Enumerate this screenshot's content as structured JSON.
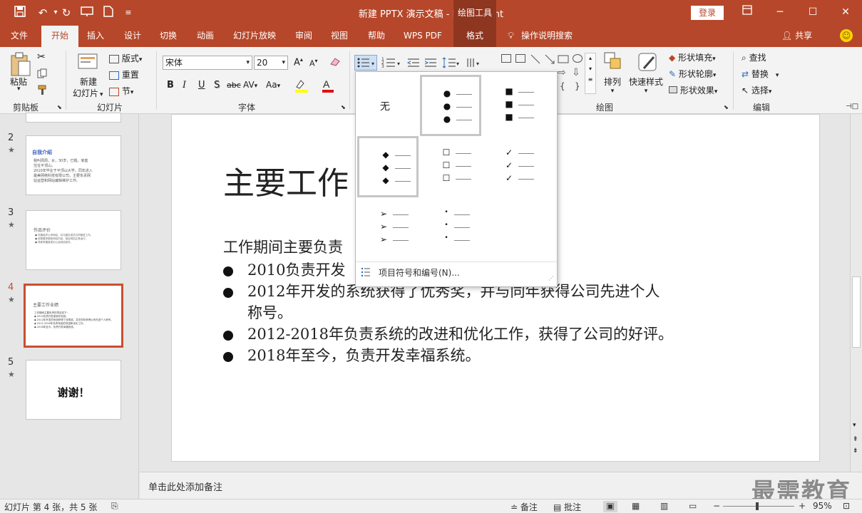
{
  "titlebar": {
    "doc_title": "新建 PPTX 演示文稿 - PowerPoint",
    "drawing_tools": "绘图工具",
    "login": "登录",
    "minimize": "─",
    "maximize": "☐",
    "close": "✕"
  },
  "tabs": [
    {
      "label": "文件"
    },
    {
      "label": "开始"
    },
    {
      "label": "插入"
    },
    {
      "label": "设计"
    },
    {
      "label": "切换"
    },
    {
      "label": "动画"
    },
    {
      "label": "幻灯片放映"
    },
    {
      "label": "审阅"
    },
    {
      "label": "视图"
    },
    {
      "label": "帮助"
    },
    {
      "label": "WPS PDF"
    },
    {
      "label": "格式"
    }
  ],
  "tell_me": "操作说明搜索",
  "share": "共享",
  "ribbon": {
    "clipboard": {
      "label": "剪贴板",
      "paste": "粘贴"
    },
    "slides": {
      "label": "幻灯片",
      "new_slide_1": "新建",
      "new_slide_2": "幻灯片",
      "layout": "版式",
      "reset": "重置",
      "section": "节"
    },
    "font": {
      "label": "字体",
      "font_name": "宋体",
      "font_size": "20",
      "bold": "B",
      "italic": "I",
      "underline": "U",
      "shadow": "S",
      "strike": "abc",
      "spacing": "AV",
      "case": "Aa"
    },
    "drawing": {
      "label": "绘图",
      "arrange": "排列",
      "quick_styles": "快速样式",
      "fill": "形状填充",
      "outline": "形状轮廓",
      "effect": "形状效果"
    },
    "editing": {
      "label": "编辑",
      "find": "查找",
      "replace": "替换",
      "select": "选择"
    }
  },
  "slides": [
    {
      "num": "2",
      "title": "自我介绍",
      "lines": [
        "我叫周周，女，30岁，已婚，家庭",
        "住址平顶山。",
        "2010年毕业于平顶山大学，同年进入",
        "最美网络科技有限公司，主要负责网",
        "站运营和网站编辑维护工作。"
      ]
    },
    {
      "num": "3",
      "title": "作品评价",
      "lines": [
        "● 完善维护公司网站，并与团队成员共同推进工作。",
        "● 依照要求更新网站内容，保证网站正常运行。",
        "● 熟练掌握各类办公及网站软件。"
      ]
    },
    {
      "num": "4",
      "title": "主要工作业绩",
      "lines": [
        "工作期间主要负责的项目如下：",
        "◆ 2010负责开发某软件系统。",
        "◆ 2012年开发的系统获得了优秀奖，并在同年获得公司先进个人称号。",
        "◆ 2012-2018年负责系统的改进和优化工作。",
        "◆ 2018年至今，负责开发幸福系统。"
      ]
    },
    {
      "num": "5",
      "title": "谢谢！",
      "lines": []
    }
  ],
  "slide": {
    "title": "主要工作",
    "intro": "工作期间主要负责",
    "bullets": [
      {
        "text": "2010负责开发"
      },
      {
        "text": "2012年开发的系统获得了优秀奖，并与同年获得公司先进个人",
        "cont": "称号。"
      },
      {
        "text": "2012-2018年负责系统的改进和优化工作，获得了公司的好评。"
      },
      {
        "text": "2018年至今，负责开发幸福系统。"
      }
    ]
  },
  "dropdown": {
    "none_label": "无",
    "footer": "项目符号和编号(N)..."
  },
  "notes": {
    "placeholder": "单击此处添加备注",
    "watermark": "最需教育"
  },
  "status": {
    "slide_info": "幻灯片 第 4 张，共 5 张",
    "notes_btn": "备注",
    "comments_btn": "批注",
    "zoom": "95%"
  }
}
